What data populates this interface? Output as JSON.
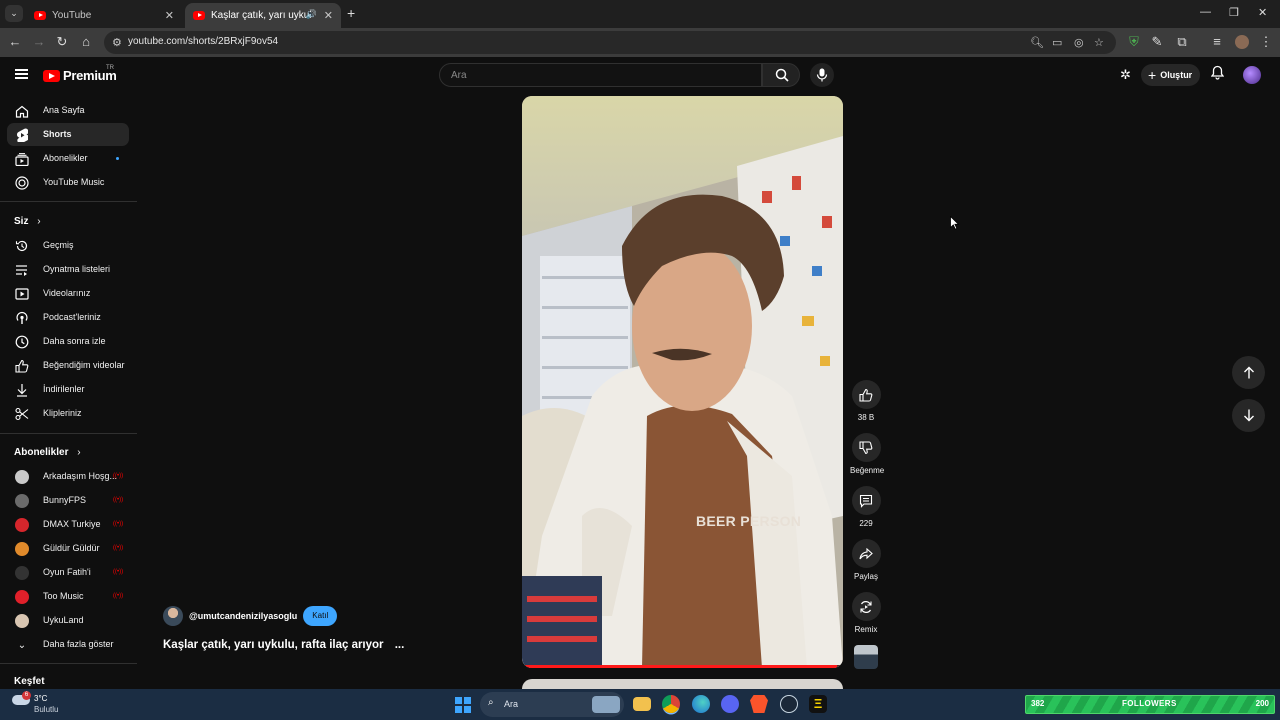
{
  "browser": {
    "tabs": [
      {
        "title": "YouTube",
        "active": false
      },
      {
        "title": "Kaşlar çatık, yarı uykulu, raf",
        "active": true
      }
    ],
    "url": "youtube.com/shorts/2BRxjF9ov54"
  },
  "header": {
    "logo_text": "Premium",
    "logo_badge": "TR",
    "search_placeholder": "Ara",
    "create_label": "Oluştur"
  },
  "sidebar": {
    "main_items": [
      {
        "label": "Ana Sayfa",
        "icon": "home-icon"
      },
      {
        "label": "Shorts",
        "icon": "shorts-icon",
        "active": true
      },
      {
        "label": "Abonelikler",
        "icon": "subscriptions-icon"
      },
      {
        "label": "YouTube Music",
        "icon": "music-icon"
      }
    ],
    "you_heading": "Siz",
    "you_items": [
      {
        "label": "Geçmiş",
        "icon": "history-icon"
      },
      {
        "label": "Oynatma listeleri",
        "icon": "playlists-icon"
      },
      {
        "label": "Videolarınız",
        "icon": "your-videos-icon"
      },
      {
        "label": "Podcast'leriniz",
        "icon": "podcast-icon"
      },
      {
        "label": "Daha sonra izle",
        "icon": "watch-later-icon"
      },
      {
        "label": "Beğendiğim videolar",
        "icon": "liked-icon"
      },
      {
        "label": "İndirilenler",
        "icon": "download-icon"
      },
      {
        "label": "Klipleriniz",
        "icon": "scissors-icon"
      }
    ],
    "subs_heading": "Abonelikler",
    "subscriptions": [
      {
        "label": "Arkadaşım Hoşg...",
        "color": "#c9c9c9"
      },
      {
        "label": "BunnyFPS",
        "color": "#6b6b6b"
      },
      {
        "label": "DMAX Turkiye",
        "color": "#d6262c"
      },
      {
        "label": "Güldür Güldür",
        "color": "#e08a2b"
      },
      {
        "label": "Oyun Fatih'i",
        "color": "#333333"
      },
      {
        "label": "Too Music",
        "color": "#e0202a"
      },
      {
        "label": "UykuLand",
        "color": "#d8c5b1"
      }
    ],
    "show_more": "Daha fazla göster",
    "explore_heading": "Keşfet"
  },
  "short": {
    "channel": "@umutcandenizilyasoglu",
    "join_label": "Katıl",
    "title": "Kaşlar çatık, yarı uykulu, rafta ilaç arıyor",
    "more": "...",
    "shirt_text": "BEER PERSON",
    "progress": 0.98,
    "likes": "38 B",
    "dislike_label": "Beğenme",
    "comments": "229",
    "share_label": "Paylaş",
    "remix_label": "Remix"
  },
  "taskbar": {
    "temp": "3°C",
    "weather": "Bulutlu",
    "weather_badge": "6",
    "search_placeholder": "Ara",
    "followers_left": "382",
    "followers_label": "FOLLOWERS",
    "followers_right": "200"
  },
  "colors": {
    "accent": "#ff0000",
    "join": "#3ea6ff",
    "followers": "#29c25a"
  }
}
